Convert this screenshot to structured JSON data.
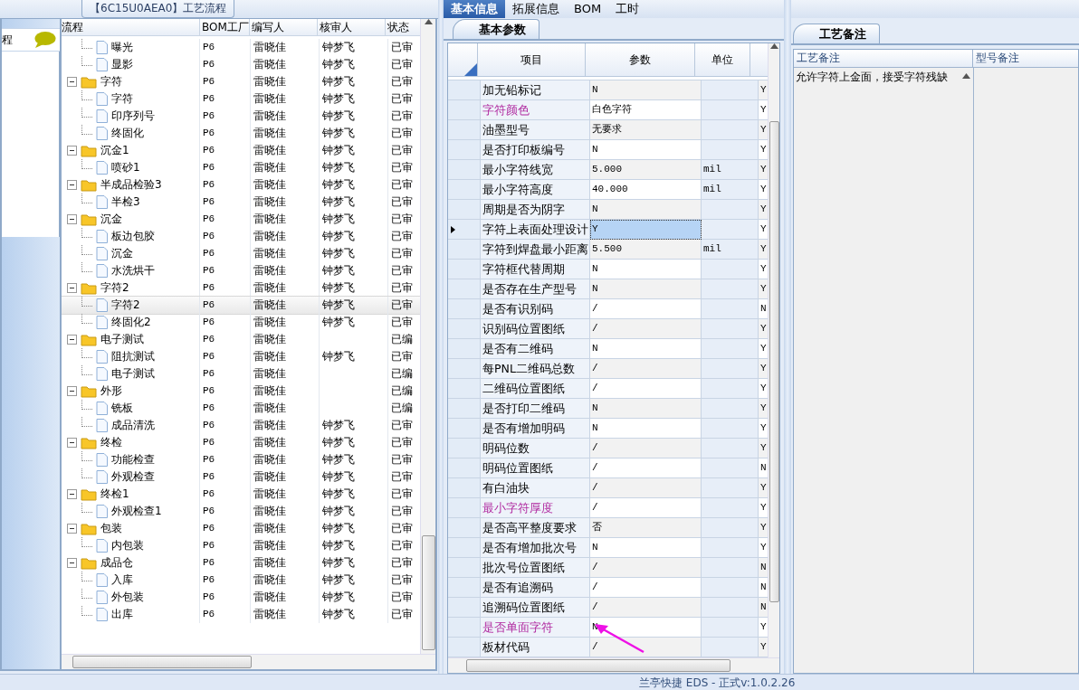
{
  "flow_panel": {
    "title": "【6C15U0AEA0】工艺流程",
    "sidebar": {
      "item": "程"
    },
    "columns": [
      "流程",
      "BOM工厂",
      "编写人",
      "核审人",
      "状态"
    ],
    "tree": [
      {
        "children": [
          {
            "label": "曝光",
            "bom": "P6",
            "writer": "雷晓佳",
            "reviewer": "钟梦飞",
            "status": "已审",
            "selected": false
          },
          {
            "label": "显影",
            "bom": "P6",
            "writer": "雷晓佳",
            "reviewer": "钟梦飞",
            "status": "已审",
            "selected": false
          }
        ]
      },
      {
        "label": "字符",
        "bom": "P6",
        "writer": "雷晓佳",
        "reviewer": "钟梦飞",
        "status": "已审",
        "selected": false,
        "expanded": true,
        "children": [
          {
            "label": "字符",
            "bom": "P6",
            "writer": "雷晓佳",
            "reviewer": "钟梦飞",
            "status": "已审",
            "selected": false
          },
          {
            "label": "印序列号",
            "bom": "P6",
            "writer": "雷晓佳",
            "reviewer": "钟梦飞",
            "status": "已审",
            "selected": false
          },
          {
            "label": "终固化",
            "bom": "P6",
            "writer": "雷晓佳",
            "reviewer": "钟梦飞",
            "status": "已审",
            "selected": false
          }
        ]
      },
      {
        "label": "沉金1",
        "bom": "P6",
        "writer": "雷晓佳",
        "reviewer": "钟梦飞",
        "status": "已审",
        "selected": false,
        "expanded": true,
        "children": [
          {
            "label": "喷砂1",
            "bom": "P6",
            "writer": "雷晓佳",
            "reviewer": "钟梦飞",
            "status": "已审",
            "selected": false
          }
        ]
      },
      {
        "label": "半成品检验3",
        "bom": "P6",
        "writer": "雷晓佳",
        "reviewer": "钟梦飞",
        "status": "已审",
        "selected": false,
        "expanded": true,
        "children": [
          {
            "label": "半检3",
            "bom": "P6",
            "writer": "雷晓佳",
            "reviewer": "钟梦飞",
            "status": "已审",
            "selected": false
          }
        ]
      },
      {
        "label": "沉金",
        "bom": "P6",
        "writer": "雷晓佳",
        "reviewer": "钟梦飞",
        "status": "已审",
        "selected": false,
        "expanded": true,
        "children": [
          {
            "label": "板边包胶",
            "bom": "P6",
            "writer": "雷晓佳",
            "reviewer": "钟梦飞",
            "status": "已审",
            "selected": false
          },
          {
            "label": "沉金",
            "bom": "P6",
            "writer": "雷晓佳",
            "reviewer": "钟梦飞",
            "status": "已审",
            "selected": false
          },
          {
            "label": "水洗烘干",
            "bom": "P6",
            "writer": "雷晓佳",
            "reviewer": "钟梦飞",
            "status": "已审",
            "selected": false
          }
        ]
      },
      {
        "label": "字符2",
        "bom": "P6",
        "writer": "雷晓佳",
        "reviewer": "钟梦飞",
        "status": "已审",
        "selected": false,
        "expanded": true,
        "children": [
          {
            "label": "字符2",
            "bom": "P6",
            "writer": "雷晓佳",
            "reviewer": "钟梦飞",
            "status": "已审",
            "selected": true
          },
          {
            "label": "终固化2",
            "bom": "P6",
            "writer": "雷晓佳",
            "reviewer": "钟梦飞",
            "status": "已审",
            "selected": false
          }
        ]
      },
      {
        "label": "电子测试",
        "bom": "P6",
        "writer": "雷晓佳",
        "status": "已编",
        "selected": false,
        "expanded": true,
        "children": [
          {
            "label": "阻抗测试",
            "bom": "P6",
            "writer": "雷晓佳",
            "reviewer": "钟梦飞",
            "status": "已审",
            "selected": false
          },
          {
            "label": "电子测试",
            "bom": "P6",
            "writer": "雷晓佳",
            "status": "已编",
            "selected": false
          }
        ]
      },
      {
        "label": "外形",
        "bom": "P6",
        "writer": "雷晓佳",
        "status": "已编",
        "selected": false,
        "expanded": true,
        "children": [
          {
            "label": "铣板",
            "bom": "P6",
            "writer": "雷晓佳",
            "status": "已编",
            "selected": false
          },
          {
            "label": "成品清洗",
            "bom": "P6",
            "writer": "雷晓佳",
            "reviewer": "钟梦飞",
            "status": "已审",
            "selected": false
          }
        ]
      },
      {
        "label": "终检",
        "bom": "P6",
        "writer": "雷晓佳",
        "reviewer": "钟梦飞",
        "status": "已审",
        "selected": false,
        "expanded": true,
        "children": [
          {
            "label": "功能检查",
            "bom": "P6",
            "writer": "雷晓佳",
            "reviewer": "钟梦飞",
            "status": "已审",
            "selected": false
          },
          {
            "label": "外观检查",
            "bom": "P6",
            "writer": "雷晓佳",
            "reviewer": "钟梦飞",
            "status": "已审",
            "selected": false
          }
        ]
      },
      {
        "label": "终检1",
        "bom": "P6",
        "writer": "雷晓佳",
        "reviewer": "钟梦飞",
        "status": "已审",
        "selected": false,
        "expanded": true,
        "children": [
          {
            "label": "外观检查1",
            "bom": "P6",
            "writer": "雷晓佳",
            "reviewer": "钟梦飞",
            "status": "已审",
            "selected": false
          }
        ]
      },
      {
        "label": "包装",
        "bom": "P6",
        "writer": "雷晓佳",
        "reviewer": "钟梦飞",
        "status": "已审",
        "selected": false,
        "expanded": true,
        "children": [
          {
            "label": "内包装",
            "bom": "P6",
            "writer": "雷晓佳",
            "reviewer": "钟梦飞",
            "status": "已审",
            "selected": false
          }
        ]
      },
      {
        "label": "成品仓",
        "bom": "P6",
        "writer": "雷晓佳",
        "reviewer": "钟梦飞",
        "status": "已审",
        "selected": false,
        "expanded": true,
        "children": [
          {
            "label": "入库",
            "bom": "P6",
            "writer": "雷晓佳",
            "reviewer": "钟梦飞",
            "status": "已审",
            "selected": false
          },
          {
            "label": "外包装",
            "bom": "P6",
            "writer": "雷晓佳",
            "reviewer": "钟梦飞",
            "status": "已审",
            "selected": false
          },
          {
            "label": "出库",
            "bom": "P6",
            "writer": "雷晓佳",
            "reviewer": "钟梦飞",
            "status": "已审",
            "selected": false
          }
        ]
      }
    ]
  },
  "info_panel": {
    "tabs": [
      {
        "label": "基本信息",
        "selected": true
      },
      {
        "label": "拓展信息",
        "selected": false
      },
      {
        "label": "BOM",
        "selected": false
      },
      {
        "label": "工时",
        "selected": false
      }
    ],
    "subtab": "基本参数",
    "columns": [
      "项目",
      "参数",
      "单位"
    ],
    "rows": [
      {
        "item": "加无铅标记",
        "value": "N",
        "column_4": "Y",
        "flagged": false,
        "selected": false
      },
      {
        "item": "字符颜色",
        "value": "白色字符",
        "column_4": "Y",
        "flagged": true,
        "selected": false
      },
      {
        "item": "油墨型号",
        "value": "无要求",
        "column_4": "Y",
        "flagged": false,
        "selected": false
      },
      {
        "item": "是否打印板编号",
        "value": "N",
        "column_4": "Y",
        "flagged": false,
        "selected": false
      },
      {
        "item": "最小字符线宽",
        "value": "5.000",
        "unit": "mil",
        "column_4": "Y",
        "flagged": false,
        "selected": false
      },
      {
        "item": "最小字符高度",
        "value": "40.000",
        "unit": "mil",
        "column_4": "Y",
        "flagged": false,
        "selected": false
      },
      {
        "item": "周期是否为阴字",
        "value": "N",
        "column_4": "Y",
        "flagged": false,
        "selected": false
      },
      {
        "item": "字符上表面处理设计",
        "value": "Y",
        "column_4": "Y",
        "flagged": false,
        "selected": true
      },
      {
        "item": "字符到焊盘最小距离",
        "value": "5.500",
        "unit": "mil",
        "column_4": "Y",
        "flagged": false,
        "selected": false
      },
      {
        "item": "字符框代替周期",
        "value": "N",
        "column_4": "Y",
        "flagged": false,
        "selected": false
      },
      {
        "item": "是否存在生产型号",
        "value": "N",
        "column_4": "Y",
        "flagged": false,
        "selected": false
      },
      {
        "item": "是否有识别码",
        "value": "/",
        "column_4": "N",
        "flagged": false,
        "selected": false
      },
      {
        "item": "识别码位置图纸",
        "value": "/",
        "column_4": "Y",
        "flagged": false,
        "selected": false
      },
      {
        "item": "是否有二维码",
        "value": "N",
        "column_4": "Y",
        "flagged": false,
        "selected": false
      },
      {
        "item": "每PNL二维码总数",
        "value": "/",
        "column_4": "Y",
        "flagged": false,
        "selected": false
      },
      {
        "item": "二维码位置图纸",
        "value": "/",
        "column_4": "Y",
        "flagged": false,
        "selected": false
      },
      {
        "item": "是否打印二维码",
        "value": "N",
        "column_4": "Y",
        "flagged": false,
        "selected": false
      },
      {
        "item": "是否有增加明码",
        "value": "N",
        "column_4": "Y",
        "flagged": false,
        "selected": false
      },
      {
        "item": "明码位数",
        "value": "/",
        "column_4": "Y",
        "flagged": false,
        "selected": false
      },
      {
        "item": "明码位置图纸",
        "value": "/",
        "column_4": "N",
        "flagged": false,
        "selected": false
      },
      {
        "item": "有白油块",
        "value": "/",
        "column_4": "Y",
        "flagged": false,
        "selected": false
      },
      {
        "item": "最小字符厚度",
        "value": "/",
        "column_4": "Y",
        "flagged": true,
        "selected": false
      },
      {
        "item": "是否高平整度要求",
        "value": "否",
        "column_4": "Y",
        "flagged": false,
        "selected": false
      },
      {
        "item": "是否有增加批次号",
        "value": "N",
        "column_4": "Y",
        "flagged": false,
        "selected": false
      },
      {
        "item": "批次号位置图纸",
        "value": "/",
        "column_4": "N",
        "flagged": false,
        "selected": false
      },
      {
        "item": "是否有追溯码",
        "value": "/",
        "column_4": "N",
        "flagged": false,
        "selected": false
      },
      {
        "item": "追溯码位置图纸",
        "value": "/",
        "column_4": "N",
        "flagged": false,
        "selected": false
      },
      {
        "item": "是否单面字符",
        "value": "N",
        "column_4": "Y",
        "flagged": true,
        "selected": false
      },
      {
        "item": "板材代码",
        "value": "/",
        "column_4": "Y",
        "flagged": false,
        "selected": false
      }
    ]
  },
  "notes_panel": {
    "subtab": "工艺备注",
    "columns": [
      "工艺备注",
      "型号备注"
    ],
    "process_note": "允许字符上金面，接受字符残缺"
  },
  "status_bar": {
    "text": "兰亭快捷 EDS - 正式v:1.0.2.26"
  }
}
